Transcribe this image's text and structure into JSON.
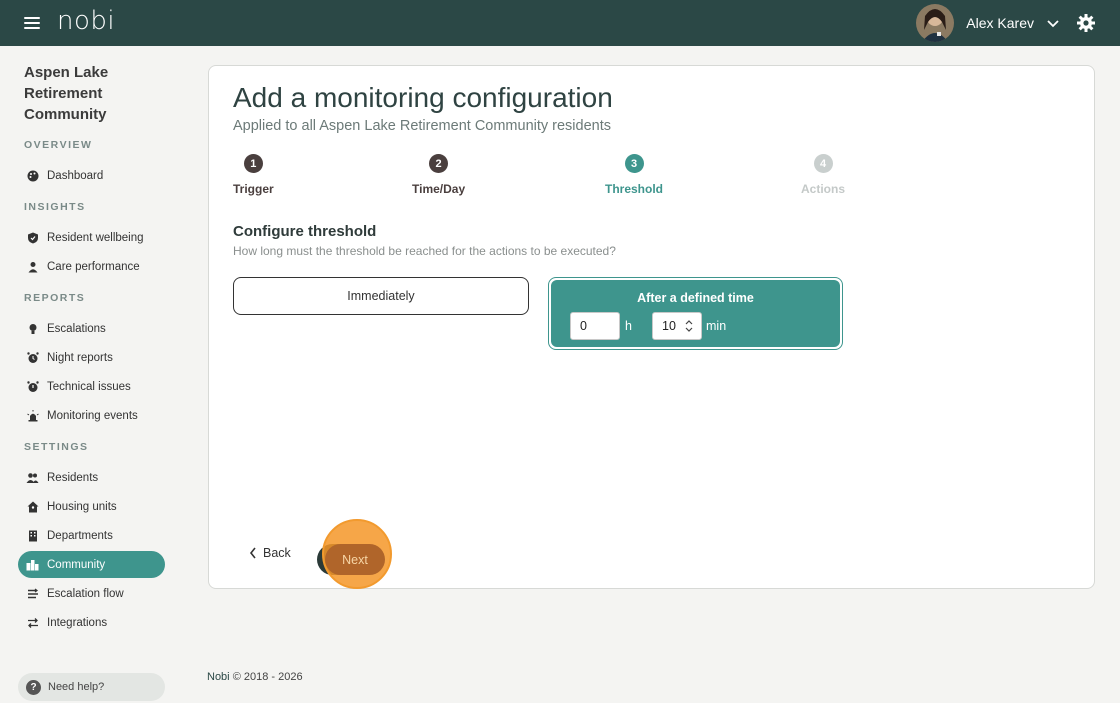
{
  "header": {
    "logo": "nobi",
    "user_name": "Alex Karev"
  },
  "sidebar": {
    "community_name": "Aspen Lake Retirement Community",
    "sections": {
      "overview": "OVERVIEW",
      "insights": "INSIGHTS",
      "reports": "REPORTS",
      "settings": "SETTINGS"
    },
    "items": {
      "dashboard": "Dashboard",
      "resident_wellbeing": "Resident wellbeing",
      "care_performance": "Care performance",
      "escalations": "Escalations",
      "night_reports": "Night reports",
      "technical_issues": "Technical issues",
      "monitoring_events": "Monitoring events",
      "residents": "Residents",
      "housing_units": "Housing units",
      "departments": "Departments",
      "community": "Community",
      "escalation_flow": "Escalation flow",
      "integrations": "Integrations"
    },
    "help": "Need help?"
  },
  "main": {
    "title": "Add a monitoring configuration",
    "subtitle": "Applied to all Aspen Lake Retirement Community residents",
    "steps": [
      {
        "num": "1",
        "label": "Trigger"
      },
      {
        "num": "2",
        "label": "Time/Day"
      },
      {
        "num": "3",
        "label": "Threshold"
      },
      {
        "num": "4",
        "label": "Actions"
      }
    ],
    "section_title": "Configure threshold",
    "section_subtitle": "How long must the threshold be reached for the actions to be executed?",
    "option_immediately": "Immediately",
    "option_defined": "After a defined time",
    "hours_value": "0",
    "hours_unit": "h",
    "minutes_value": "10",
    "minutes_unit": "min",
    "back_label": "Back",
    "next_label": "Next"
  },
  "footer": {
    "brand": "Nobi",
    "copyright": "© 2018 - 2026"
  },
  "colors": {
    "topbar": "#2b4846",
    "accent": "#3e958d",
    "highlight": "#f29a2e"
  }
}
